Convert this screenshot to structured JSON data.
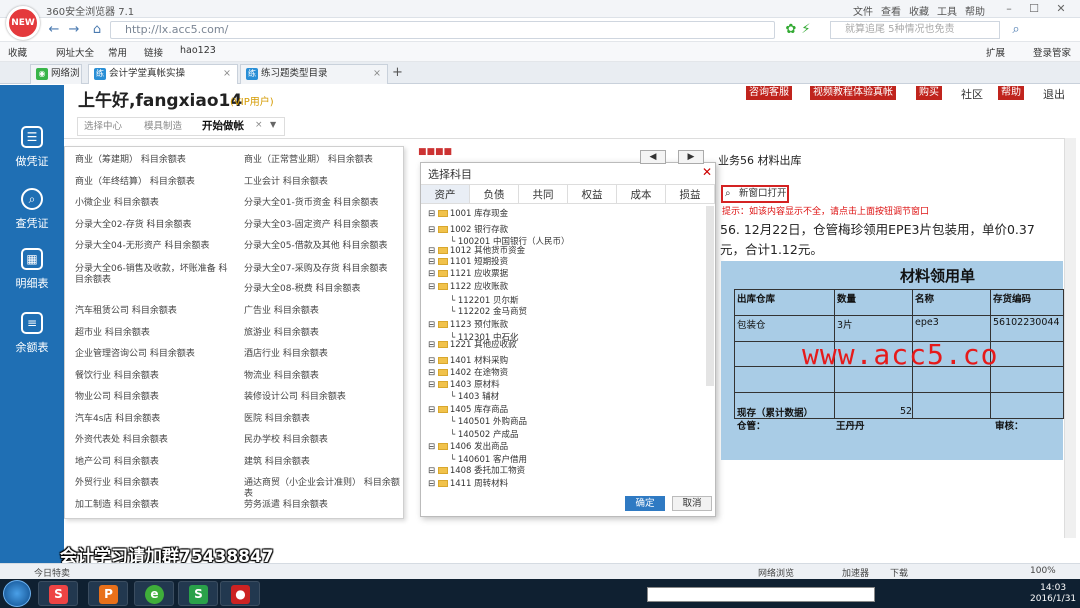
{
  "browser": {
    "title": "360安全浏览器 7.1",
    "logo": "NEW",
    "menu": [
      "文件",
      "查看",
      "收藏",
      "工具",
      "帮助"
    ],
    "url": "http://lx.acc5.com/",
    "search_placeholder": "就算追尾 5种情况也免责",
    "bookmarks": [
      "收藏",
      "网址大全",
      "常用",
      "链接",
      "hao123"
    ],
    "bm_right": [
      "扩展",
      "登录管家"
    ],
    "tabs": [
      "网络浏览",
      "会计学堂真帐实操",
      "练习题类型目录"
    ],
    "status": [
      "今日特卖",
      "网络浏览",
      "加速器",
      "下载",
      "100%"
    ]
  },
  "sidebar": {
    "items": [
      "做凭证",
      "查凭证",
      "明细表",
      "余额表"
    ]
  },
  "header": {
    "greeting": "上午好,fangxiao14",
    "vip": "(VIP用户)",
    "buttons": [
      "咨询客服",
      "视频教程体验真帐",
      "购买"
    ],
    "links": [
      "社区",
      "帮助",
      "退出"
    ],
    "subtabs": [
      "选择中心",
      "模具制造",
      "开始做帐"
    ]
  },
  "dropdown": {
    "left": [
      "商业（筹建期） 科目余额表",
      "商业（年终结算） 科目余额表",
      "小微企业 科目余额表",
      "分录大全02-存货 科目余额表",
      "分录大全04-无形资产 科目余额表",
      "分录大全06-销售及收款，坏账准备 科目余额表",
      "汽车租赁公司 科目余额表",
      "超市业 科目余额表",
      "企业管理咨询公司 科目余额表",
      "餐饮行业 科目余额表",
      "物业公司 科目余额表",
      "汽车4s店 科目余额表",
      "外资代表处 科目余额表",
      "地产公司 科目余额表",
      "外贸行业 科目余额表",
      "加工制造 科目余额表"
    ],
    "right": [
      "商业（正常营业期） 科目余额表",
      "工业会计 科目余额表",
      "分录大全01-货币资金 科目余额表",
      "分录大全03-固定资产 科目余额表",
      "分录大全05-借款及其他 科目余额表",
      "分录大全07-采购及存货 科目余额表",
      "分录大全08-税费 科目余额表",
      "广告业 科目余额表",
      "旅游业 科目余额表",
      "酒店行业 科目余额表",
      "物流业 科目余额表",
      "装修设计公司 科目余额表",
      "医院 科目余额表",
      "民办学校 科目余额表",
      "建筑 科目余额表",
      "通达商贸（小企业会计准则） 科目余额表",
      "劳务派遣 科目余额表"
    ]
  },
  "dialog": {
    "title": "选择科目",
    "tabs": [
      "资产",
      "负债",
      "共同",
      "权益",
      "成本",
      "损益"
    ],
    "tree": [
      [
        "1001 库存现金",
        0
      ],
      [
        "1002 银行存款",
        0
      ],
      [
        "100201 中国银行（人民币）",
        1
      ],
      [
        "1012 其他货币资金",
        0
      ],
      [
        "1101 短期投资",
        0
      ],
      [
        "1121 应收票据",
        0
      ],
      [
        "1122 应收账款",
        0
      ],
      [
        "112201 贝尔斯",
        1
      ],
      [
        "112202 金马商贸",
        1
      ],
      [
        "1123 预付账款",
        0
      ],
      [
        "112301 中石化",
        1
      ],
      [
        "1221 其他应收款",
        0
      ],
      [
        "1401 材料采购",
        0
      ],
      [
        "1402 在途物资",
        0
      ],
      [
        "1403 原材料",
        0
      ],
      [
        "1403 辅材",
        1
      ],
      [
        "1405 库存商品",
        0
      ],
      [
        "140501 外购商品",
        1
      ],
      [
        "140502 产成品",
        1
      ],
      [
        "1406 发出商品",
        0
      ],
      [
        "140601 客户借用",
        1
      ],
      [
        "1408 委托加工物资",
        0
      ],
      [
        "1411 周转材料",
        0
      ]
    ],
    "ok": "确定",
    "cancel": "取消"
  },
  "task": {
    "title": "业务56 材料出库",
    "new_window": "新窗口打开",
    "hint": "提示：如该内容显示不全，请点击上面按钮调节窗口",
    "question": "56. 12月22日，仓管梅珍领用EPE3片包装用，单价0.37元，合计1.12元。",
    "form_title": "材料领用单",
    "headers": [
      "出库仓库",
      "数量",
      "名称",
      "存货编码"
    ],
    "row": [
      "包装仓",
      "3片",
      "epe3",
      "56102230044"
    ],
    "stock_label": "现存（累计数据）",
    "stock_value": "52",
    "keeper_label": "仓管：",
    "keeper": "王丹丹",
    "audit": "审核：",
    "watermark": "www.acc5.co"
  },
  "overlay": "会计学习请加群75438847",
  "clock": {
    "time": "14:03",
    "date": "2016/1/31"
  }
}
